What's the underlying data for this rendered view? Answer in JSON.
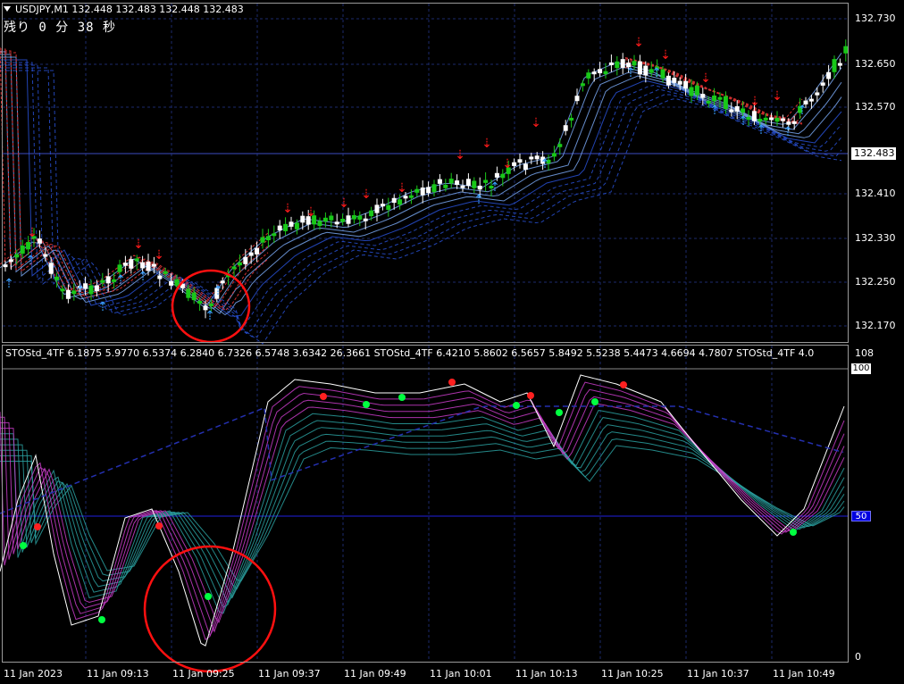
{
  "symbol_header": "USDJPY,M1  132.448 132.483 132.448 132.483",
  "countdown": "残り 0 分 38 秒",
  "current_price": "132.483",
  "price_axis": [
    "132.730",
    "132.650",
    "132.570",
    "132.410",
    "132.330",
    "132.250",
    "132.170"
  ],
  "indicator_header": "STOStd_4TF 6.1875 5.9770 6.5374 6.2840 6.7326 6.5748 3.6342 26.3661  STOStd_4TF 6.4210 5.8602 6.5657 5.8492 5.5238 5.4473 4.6694 4.7807  STOStd_4TF 4.0",
  "indicator_axis": {
    "top": "108",
    "level100": "100",
    "level50": "50",
    "bottom": "0"
  },
  "time_axis": [
    "11 Jan 2023",
    "11 Jan 09:13",
    "11 Jan 09:25",
    "11 Jan 09:37",
    "11 Jan 09:49",
    "11 Jan 10:01",
    "11 Jan 10:13",
    "11 Jan 10:25",
    "11 Jan 10:37",
    "11 Jan 10:49"
  ],
  "colors": {
    "bull": "#19c819",
    "bear": "#ffffff",
    "grid": "#1b2a6b",
    "sell_arrow": "#ff1a1a",
    "buy_arrow": "#3aa0ff",
    "stoch_main": "#ffffff",
    "stoch_fan_a": "#c83cc8",
    "stoch_fan_b": "#2aa0a0",
    "signal_up": "#00ff40",
    "signal_down": "#ff2020",
    "highlight_circle": "#ff1010"
  }
}
